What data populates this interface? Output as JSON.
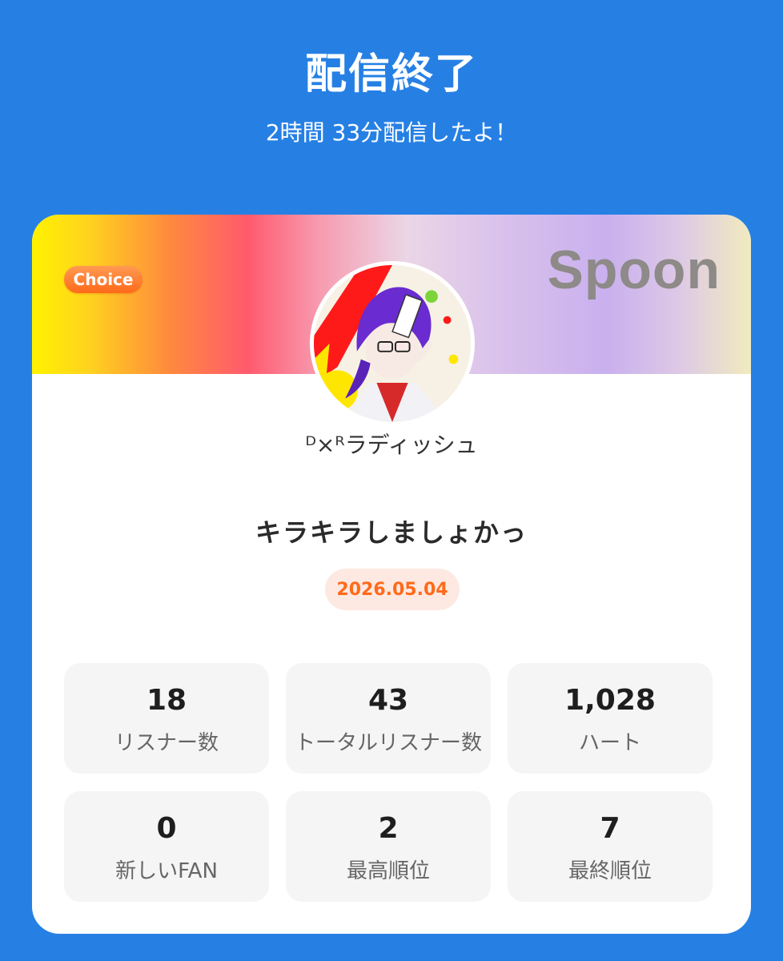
{
  "header": {
    "title": "配信終了",
    "subtitle": "2時間 33分配信したよ！"
  },
  "card": {
    "badge": "Choice",
    "brand": "Spoon",
    "username": "ᴰ×ᴿラディッシュ",
    "stream_title": "キラキラしましょかっ",
    "date": "2026.05.04"
  },
  "stats": [
    {
      "value": "18",
      "label": "リスナー数"
    },
    {
      "value": "43",
      "label": "トータルリスナー数"
    },
    {
      "value": "1,028",
      "label": "ハート"
    },
    {
      "value": "0",
      "label": "新しいFAN"
    },
    {
      "value": "2",
      "label": "最高順位"
    },
    {
      "value": "7",
      "label": "最終順位"
    }
  ],
  "colors": {
    "background": "#2680e4",
    "accent_orange": "#ff6a1a",
    "date_pill_bg": "#fde9e2",
    "stat_bg": "#f5f5f5"
  }
}
